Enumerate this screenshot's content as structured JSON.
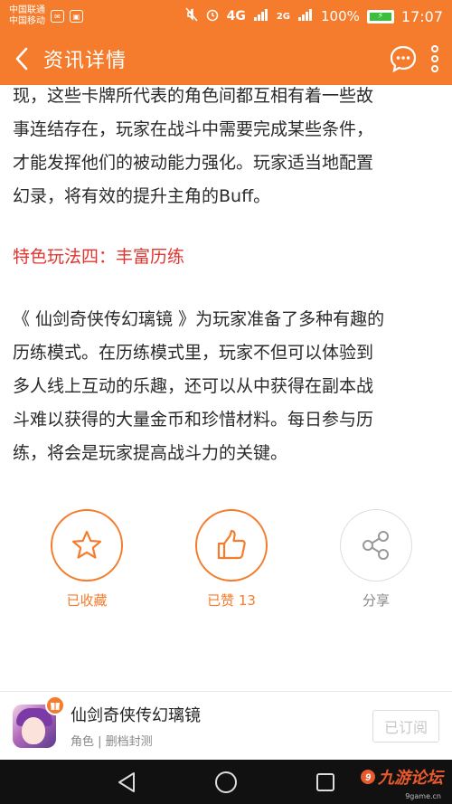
{
  "status_bar": {
    "carrier1": "中国联通",
    "carrier2": "中国移动",
    "network_4g": "4G",
    "network_2g": "2G",
    "battery": "100%",
    "time": "17:07"
  },
  "header": {
    "title": "资讯详情",
    "back_icon": "back-arrow-icon",
    "comment_icon": "chat-bubble-icon",
    "more_icon": "more-vertical-icon"
  },
  "article": {
    "para1_lines": [
      "现，这些卡牌所代表的角色间都互相有着一些故",
      "事连结存在，玩家在战斗中需要完成某些条件，",
      "才能发挥他们的被动能力强化。玩家适当地配置",
      "幻录，将有效的提升主角的Buff。"
    ],
    "heading": "特色玩法四：丰富历练",
    "para2_lines": [
      "《 仙剑奇侠传幻璃镜 》为玩家准备了多种有趣的",
      "历练模式。在历练模式里，玩家不但可以体验到",
      "多人线上互动的乐趣，还可以从中获得在副本战",
      "斗难以获得的大量金币和珍惜材料。每日参与历",
      "练，将会是玩家提高战斗力的关键。"
    ]
  },
  "actions": {
    "favorite_label": "已收藏",
    "like_label": "已赞 13",
    "share_label": "分享"
  },
  "app_card": {
    "name": "仙剑奇侠传幻璃镜",
    "meta": "角色 | 删档封测",
    "subscribe_label": "已订阅"
  },
  "watermark": {
    "text": "九游论坛",
    "sub": "9game.cn"
  },
  "colors": {
    "accent": "#f47c2c",
    "heading_red": "#e2342f",
    "text": "#2a2a2a"
  }
}
